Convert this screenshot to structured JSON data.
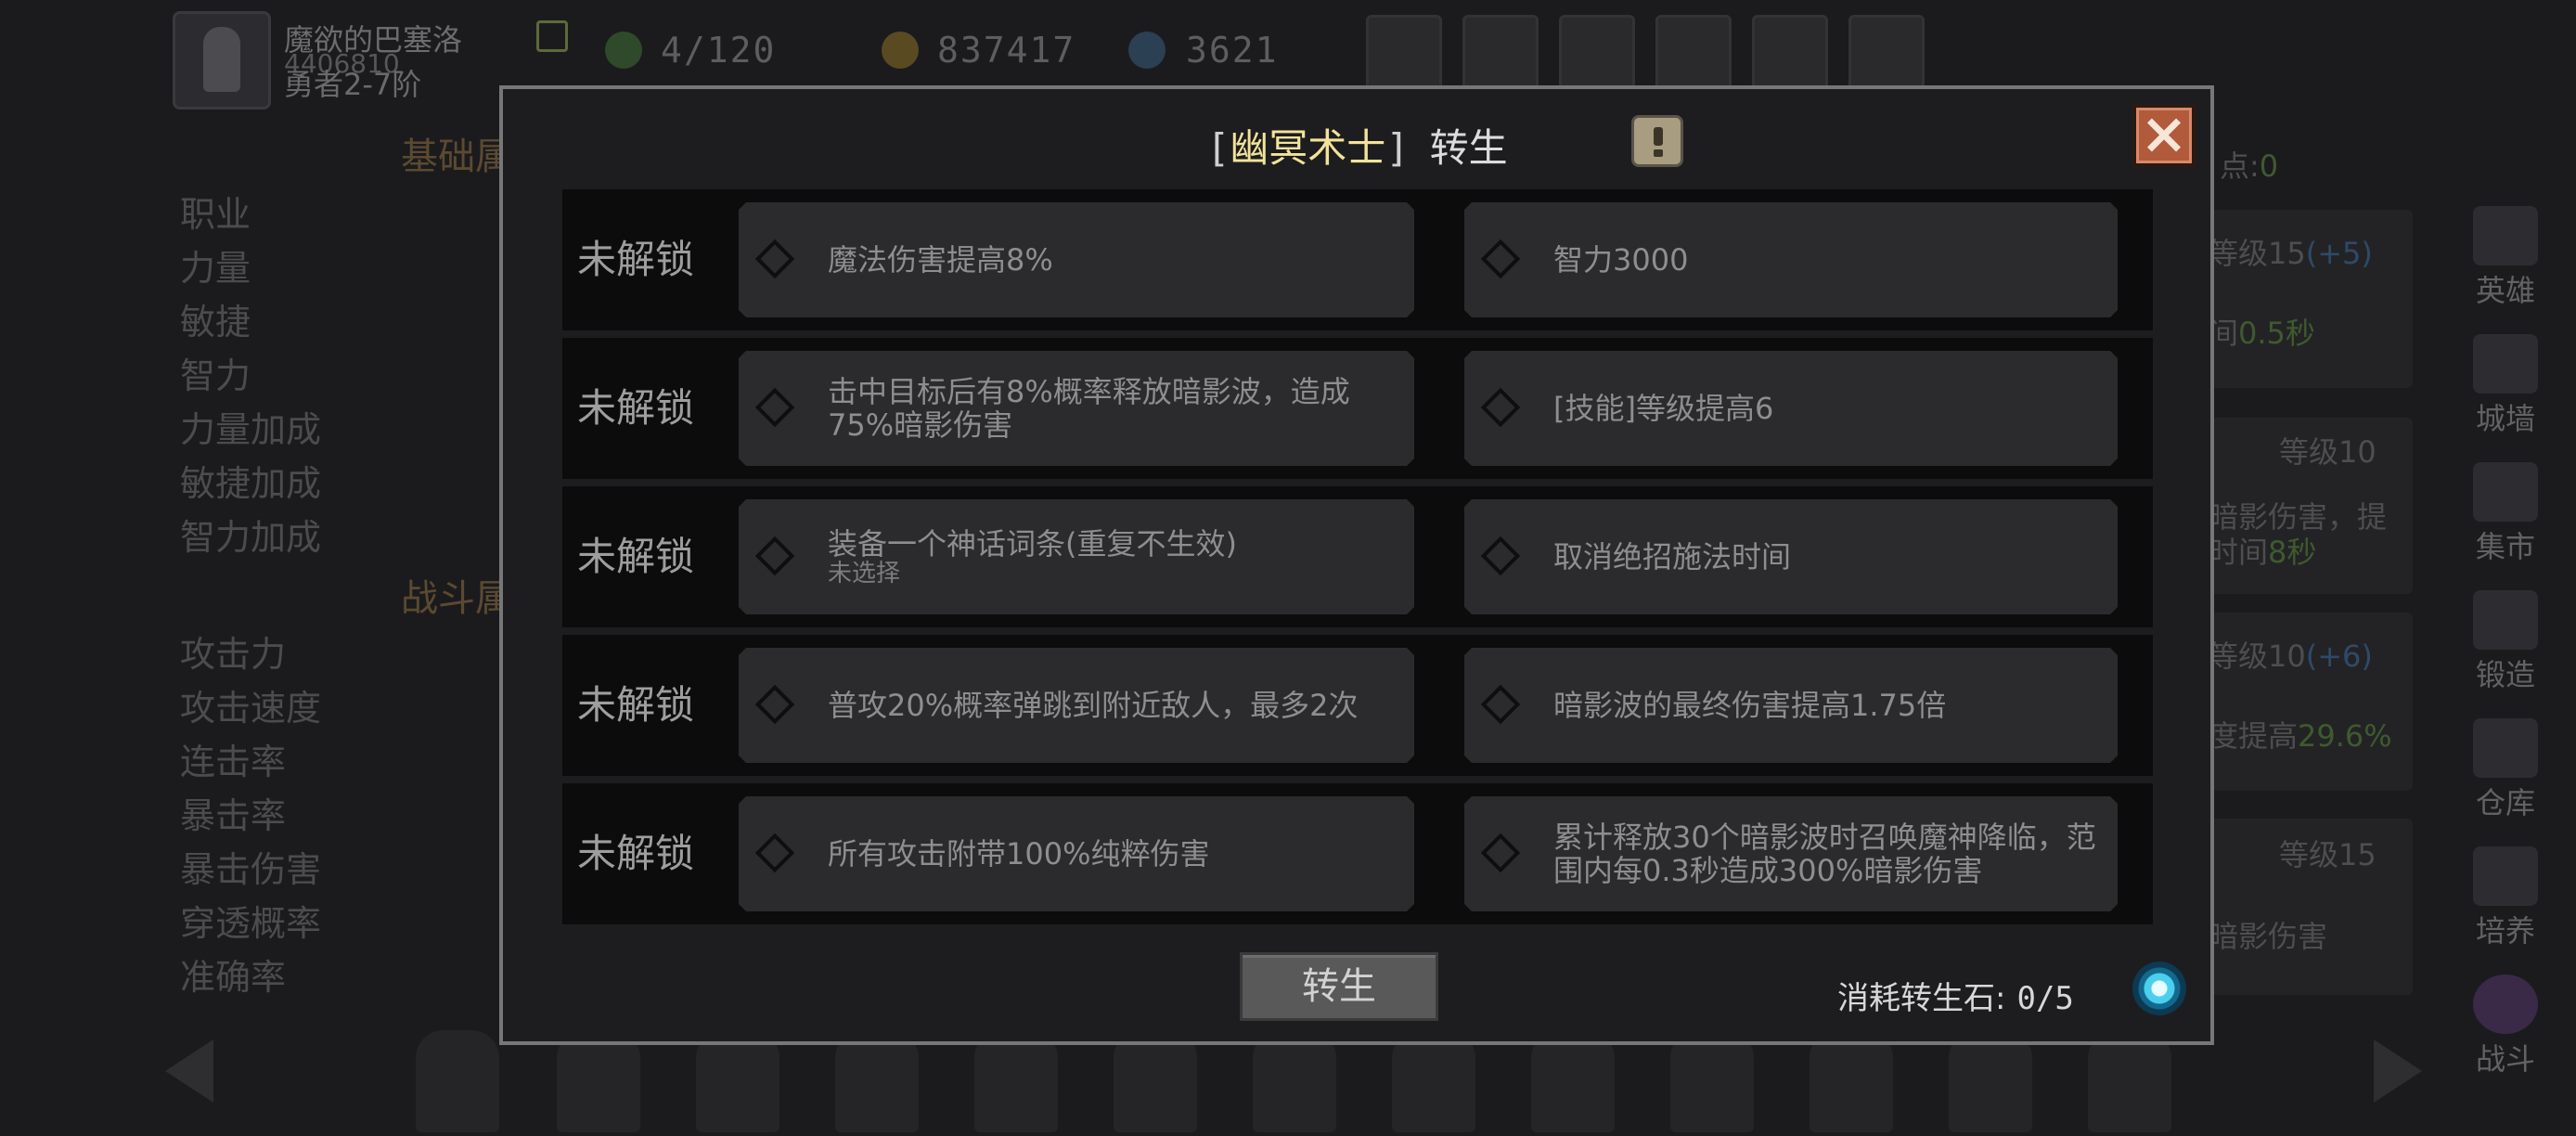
{
  "player": {
    "name": "魔欲的巴塞洛",
    "id": "4406810",
    "rank": "勇者2-7阶"
  },
  "resources": {
    "stamina": "4/120",
    "gold": "837417",
    "gems": "3621"
  },
  "top_buttons": [
    "cart-icon",
    "mail-icon",
    "gamepad-icon",
    "gear-icon",
    "wheel-icon",
    "sword-icon"
  ],
  "left_panel": {
    "section_basic": "基础属",
    "basic_stats": [
      "职业",
      "力量",
      "敏捷",
      "智力",
      "力量加成",
      "敏捷加成",
      "智力加成"
    ],
    "section_combat": "战斗属",
    "combat_stats": [
      "攻击力",
      "攻击速度",
      "连击率",
      "暴击率",
      "暴击伤害",
      "穿透概率",
      "准确率"
    ]
  },
  "right_panel": {
    "points_label": "点:",
    "points_value": "0",
    "texts": [
      {
        "a": "等级15",
        "b": "(+5)"
      },
      {
        "a": "间",
        "b": "0.5秒"
      },
      {
        "a": "等级10",
        "b": ""
      },
      {
        "a": "暗影伤害，提",
        "b": ""
      },
      {
        "a": "时间",
        "b": "8秒"
      },
      {
        "a": "等级10",
        "b": "(+6)"
      },
      {
        "a": "度提高",
        "b": "29.6%"
      },
      {
        "a": "等级15",
        "b": ""
      },
      {
        "a": "暗影伤害",
        "b": ""
      }
    ]
  },
  "side_nav": [
    "英雄",
    "城墙",
    "集市",
    "锻造",
    "仓库",
    "培养",
    "战斗"
  ],
  "modal": {
    "title_open": "[",
    "title_class": "幽冥术士",
    "title_close": "]",
    "title_action": "转生",
    "rows": [
      {
        "status": "未解锁",
        "left": {
          "text": "魔法伤害提高8%",
          "sub": ""
        },
        "right": {
          "text": "智力3000",
          "sub": ""
        }
      },
      {
        "status": "未解锁",
        "left": {
          "text": "击中目标后有8%概率释放暗影波，造成75%暗影伤害",
          "sub": ""
        },
        "right": {
          "text": "[技能]等级提高6",
          "sub": ""
        }
      },
      {
        "status": "未解锁",
        "left": {
          "text": "装备一个神话词条(重复不生效)",
          "sub": "未选择"
        },
        "right": {
          "text": "取消绝招施法时间",
          "sub": ""
        }
      },
      {
        "status": "未解锁",
        "left": {
          "text": "普攻20%概率弹跳到附近敌人，最多2次",
          "sub": ""
        },
        "right": {
          "text": "暗影波的最终伤害提高1.75倍",
          "sub": ""
        }
      },
      {
        "status": "未解锁",
        "left": {
          "text": "所有攻击附带100%纯粹伤害",
          "sub": ""
        },
        "right": {
          "text": "累计释放30个暗影波时召唤魔神降临，范围内每0.3秒造成300%暗影伤害",
          "sub": ""
        }
      }
    ],
    "rebirth_button": "转生",
    "cost_label": "消耗转生石:",
    "cost_count": "0/5"
  }
}
